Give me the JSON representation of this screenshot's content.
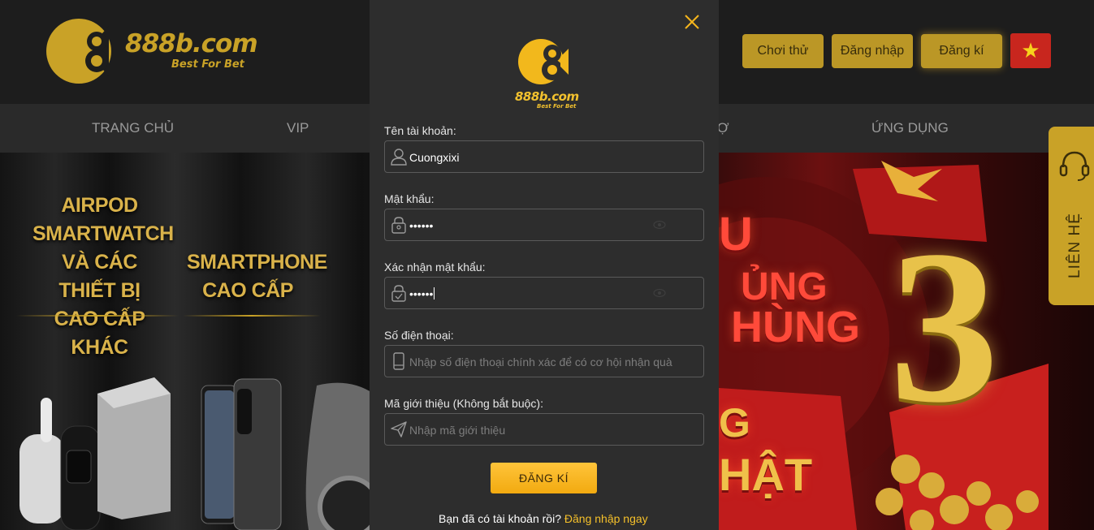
{
  "brand": {
    "name": "888b.com",
    "tagline": "Best For Bet",
    "color_gold": "#c9a227",
    "color_button": "#f5b51c"
  },
  "header": {
    "buttons": {
      "try": "Chơi thử",
      "login": "Đăng nhập",
      "register": "Đăng kí"
    },
    "language_flag": "vietnam-flag"
  },
  "nav": {
    "items": [
      "TRANG CHỦ",
      "VIP",
      "Ợ",
      "ỨNG DỤNG"
    ]
  },
  "banner": {
    "left_promo_1": [
      "AIRPOD",
      "SMARTWATCH",
      "VÀ CÁC THIẾT BỊ",
      "CAO CẤP KHÁC"
    ],
    "left_promo_2": [
      "SMARTPHONE",
      "CAO CẤP"
    ],
    "right_text": [
      "U",
      "ỦNG",
      "HÙNG",
      "G",
      "HẬT"
    ],
    "big_number": "3"
  },
  "contact_tab": {
    "label": "LIÊN HỆ"
  },
  "modal": {
    "username": {
      "label": "Tên tài khoản:",
      "value": "Cuongxixi"
    },
    "password": {
      "label": "Mật khẩu:",
      "value": "••••••"
    },
    "confirm_password": {
      "label": "Xác nhận mật khẩu:",
      "value": "••••••"
    },
    "phone": {
      "label": "Số điện thoại:",
      "placeholder": "Nhập số điện thoại chính xác để có cơ hội nhận quà"
    },
    "referral": {
      "label": "Mã giới thiệu (Không bắt buộc):",
      "placeholder": "Nhập mã giới thiệu"
    },
    "submit": "ĐĂNG KÍ",
    "footer_question": "Bạn đã có tài khoản rồi?",
    "footer_link": "Đăng nhập ngay"
  }
}
